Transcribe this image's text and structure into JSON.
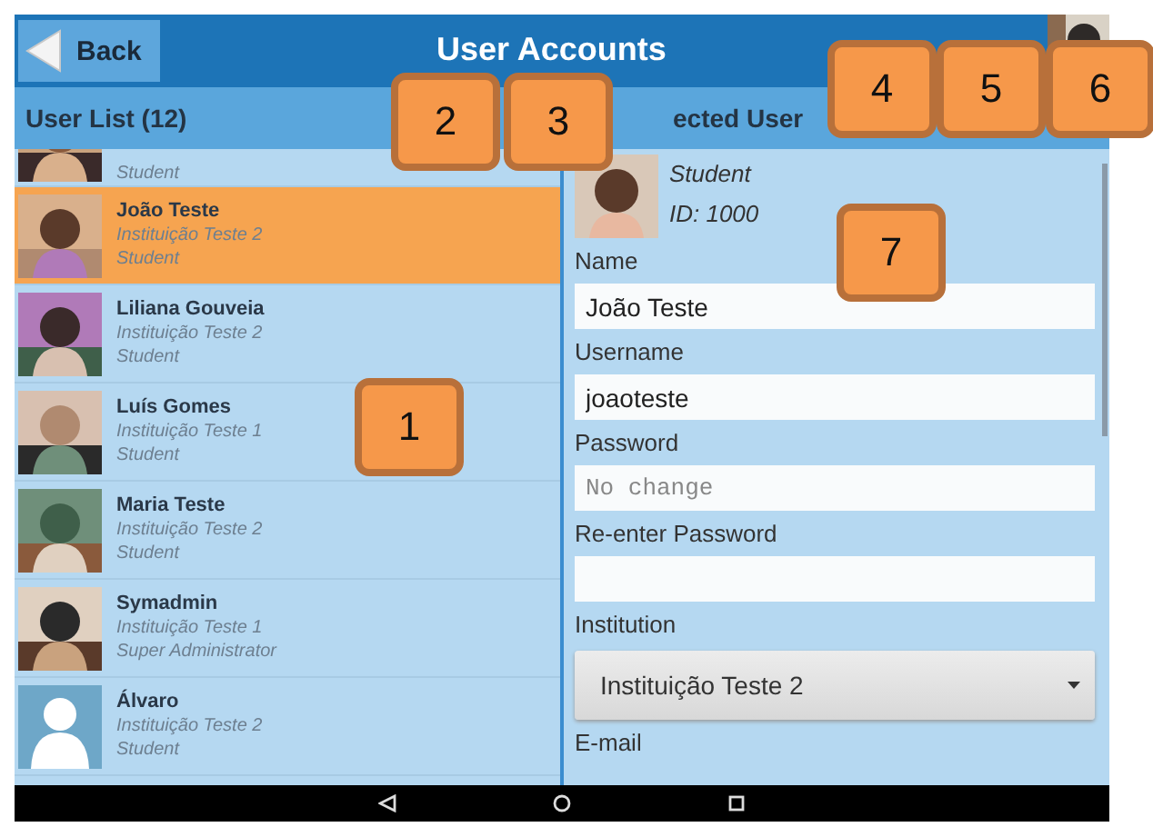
{
  "header": {
    "back_label": "Back",
    "title": "User Accounts"
  },
  "user_list": {
    "heading": "User List (12)",
    "users": [
      {
        "role": "Student",
        "selected": false
      },
      {
        "name": "João Teste",
        "institution": "Instituição Teste 2",
        "role": "Student",
        "selected": true
      },
      {
        "name": "Liliana Gouveia",
        "institution": "Instituição Teste 2",
        "role": "Student",
        "selected": false
      },
      {
        "name": "Luís Gomes",
        "institution": "Instituição Teste 1",
        "role": "Student",
        "selected": false
      },
      {
        "name": "Maria Teste",
        "institution": "Instituição Teste 2",
        "role": "Student",
        "selected": false
      },
      {
        "name": "Symadmin",
        "institution": "Instituição Teste 1",
        "role": "Super Administrator",
        "selected": false
      },
      {
        "name": "Álvaro",
        "institution": "Instituição Teste 2",
        "role": "Student",
        "kind": "silhouette",
        "selected": false
      }
    ]
  },
  "selected_user": {
    "heading": "ected User",
    "role": "Student",
    "id": "ID: 1000",
    "fields": [
      {
        "kind": "text",
        "label": "Name",
        "value": "João Teste"
      },
      {
        "kind": "text",
        "label": "Username",
        "value": "joaoteste"
      },
      {
        "kind": "password",
        "label": "Password",
        "placeholder": "No change"
      },
      {
        "kind": "password",
        "label": "Re-enter Password"
      },
      {
        "kind": "dropdown",
        "label": "Institution",
        "value": "Instituição Teste 2"
      },
      {
        "kind": "label_only",
        "label": "E-mail"
      }
    ]
  },
  "callouts": [
    "1",
    "2",
    "3",
    "4",
    "5",
    "6",
    "7"
  ]
}
